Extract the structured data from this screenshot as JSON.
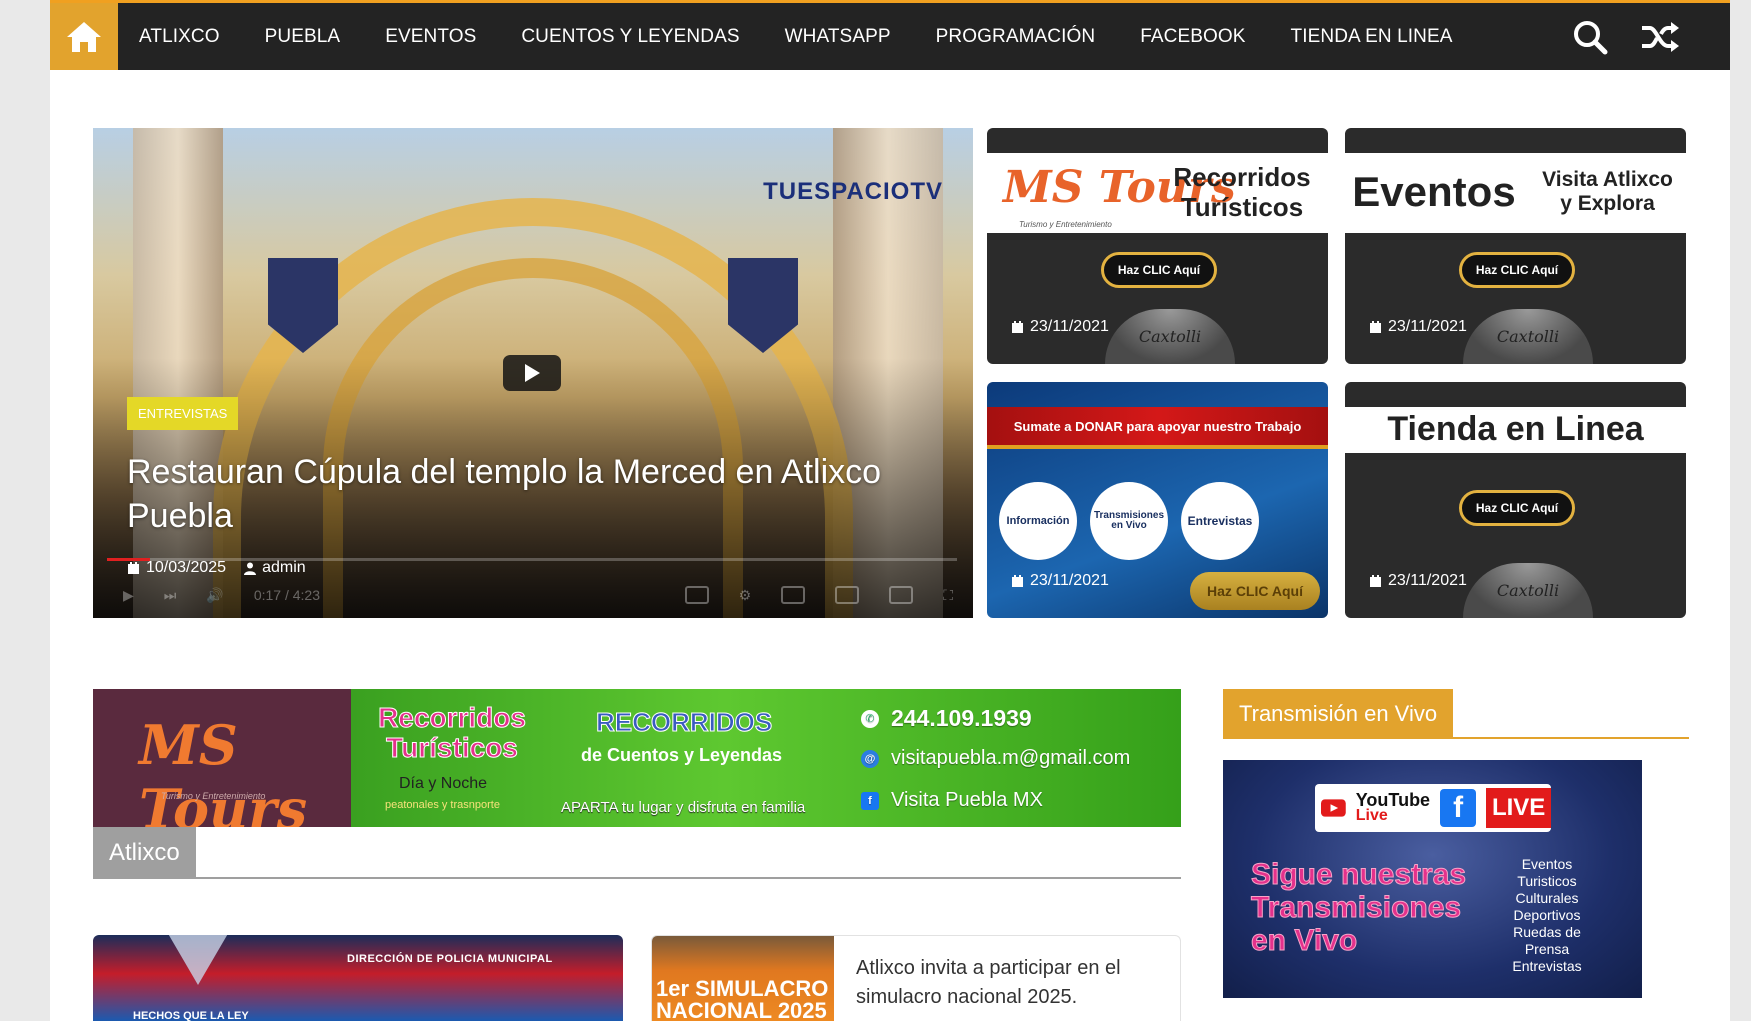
{
  "nav": {
    "items": [
      "ATLIXCO",
      "PUEBLA",
      "EVENTOS",
      "CUENTOS Y LEYENDAS",
      "WHATSAPP",
      "PROGRAMACIÓN",
      "FACEBOOK",
      "TIENDA EN LINEA"
    ],
    "icons": [
      "home-icon",
      "search-icon",
      "shuffle-icon"
    ]
  },
  "hero": {
    "badge": "ENTREVISTAS",
    "title": "Restauran Cúpula del templo la Merced en Atlixco Puebla",
    "date": "10/03/2025",
    "author": "admin",
    "watermark": "TUESPACIOTV",
    "video_time": "0:17 / 4:23",
    "progress": 0.05
  },
  "cards": [
    {
      "brand": "MS Tours",
      "brand_sub": "Turismo y Entretenimiento",
      "headline": "Recorridos Turísticos",
      "cta": "Haz CLIC Aquí",
      "date": "23/11/2021",
      "stamp": "Caxtolli"
    },
    {
      "brand": "Eventos",
      "headline": "Visita Atlixco y Explora",
      "cta": "Haz CLIC Aquí",
      "date": "23/11/2021",
      "stamp": "Caxtolli"
    },
    {
      "strip": "Sumate a DONAR para apoyar nuestro Trabajo",
      "circles": [
        "Información",
        "Transmisiones en Vivo",
        "Entrevistas"
      ],
      "cta": "Haz CLIC Aquí",
      "date": "23/11/2021"
    },
    {
      "headline": "Tienda en Linea",
      "cta": "Haz CLIC Aquí",
      "date": "23/11/2021",
      "stamp": "Caxtolli"
    }
  ],
  "ad": {
    "brand": "MS Tours",
    "brand_sub": "Turismo y Entretenimiento",
    "title": "Recorridos Turísticos",
    "subtitle": "Día y Noche",
    "note": "peatonales y trasnporte",
    "mid_title": "RECORRIDOS",
    "mid_sub": "de Cuentos y Leyendas",
    "mid_note": "APARTA tu lugar y disfruta en familia",
    "phone": "244.109.1939",
    "email": "visitapuebla.m@gmail.com",
    "facebook": "Visita Puebla MX"
  },
  "section": {
    "title": "Atlixco"
  },
  "posts": [
    {
      "org": "DIRECCIÓN DE POLICIA MUNICIPAL",
      "caption": "HECHOS QUE LA LEY"
    },
    {
      "thumb_text": "1er SIMULACRO NACIONAL 2025",
      "title": "Atlixco invita a participar en el simulacro nacional 2025."
    }
  ],
  "sidebar": {
    "title": "Transmisión en Vivo",
    "live_ad": {
      "yt_top": "YouTube",
      "yt_bottom": "Live",
      "fb": "f",
      "live": "LIVE",
      "headline": "Sigue nuestras Transmisiones en Vivo",
      "list": "Eventos Turisticos Culturales Deportivos Ruedas de Prensa Entrevistas"
    }
  }
}
